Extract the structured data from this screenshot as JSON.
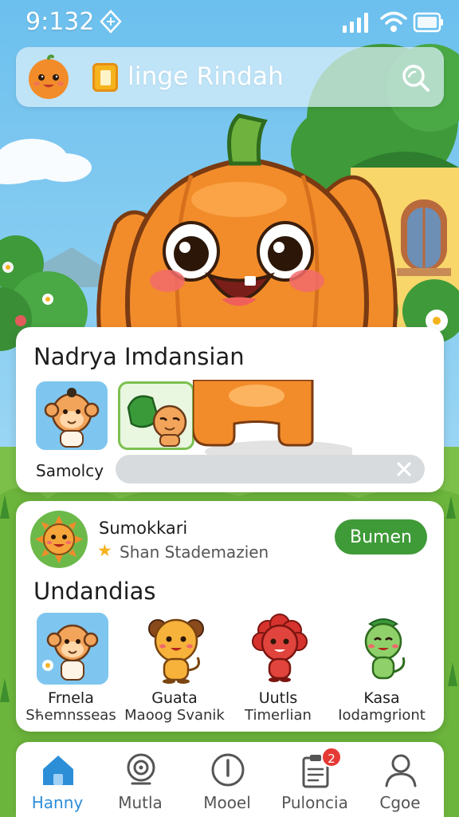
{
  "status_bar": {
    "time": "9:132"
  },
  "header": {
    "title": "linge Rindah",
    "icons": [
      "pumpkin-avatar-icon",
      "bookmark-tag-icon",
      "search-icon"
    ]
  },
  "card_featured": {
    "title": "Nadrya Imdansian",
    "label": "Samolcy",
    "progress": 0.0
  },
  "card_characters": {
    "profile_name": "Sumokkari",
    "profile_subtitle": "Shan Stademazien",
    "action_button": "Bumen",
    "section_title": "Undandias",
    "characters": [
      {
        "name": "Frnela",
        "subtitle": "Sћemnsseas"
      },
      {
        "name": "Guata",
        "subtitle": "Maoog Svanik"
      },
      {
        "name": "Uutls",
        "subtitle": "Timerlian"
      },
      {
        "name": "Kasa",
        "subtitle": "Iodamgriont"
      }
    ]
  },
  "bottom_nav": {
    "items": [
      {
        "label": "Hanny",
        "icon": "home-icon",
        "active": true
      },
      {
        "label": "Mutla",
        "icon": "target-icon",
        "active": false
      },
      {
        "label": "Mooel",
        "icon": "clock-icon",
        "active": false
      },
      {
        "label": "Puloncia",
        "icon": "clipboard-icon",
        "active": false,
        "badge": "2"
      },
      {
        "label": "Cgoe",
        "icon": "profile-icon",
        "active": false
      }
    ]
  },
  "colors": {
    "sky": "#7fc9ee",
    "accent_green": "#3f9a38",
    "active_blue": "#2d8ed8",
    "pumpkin": "#f28c2a"
  }
}
